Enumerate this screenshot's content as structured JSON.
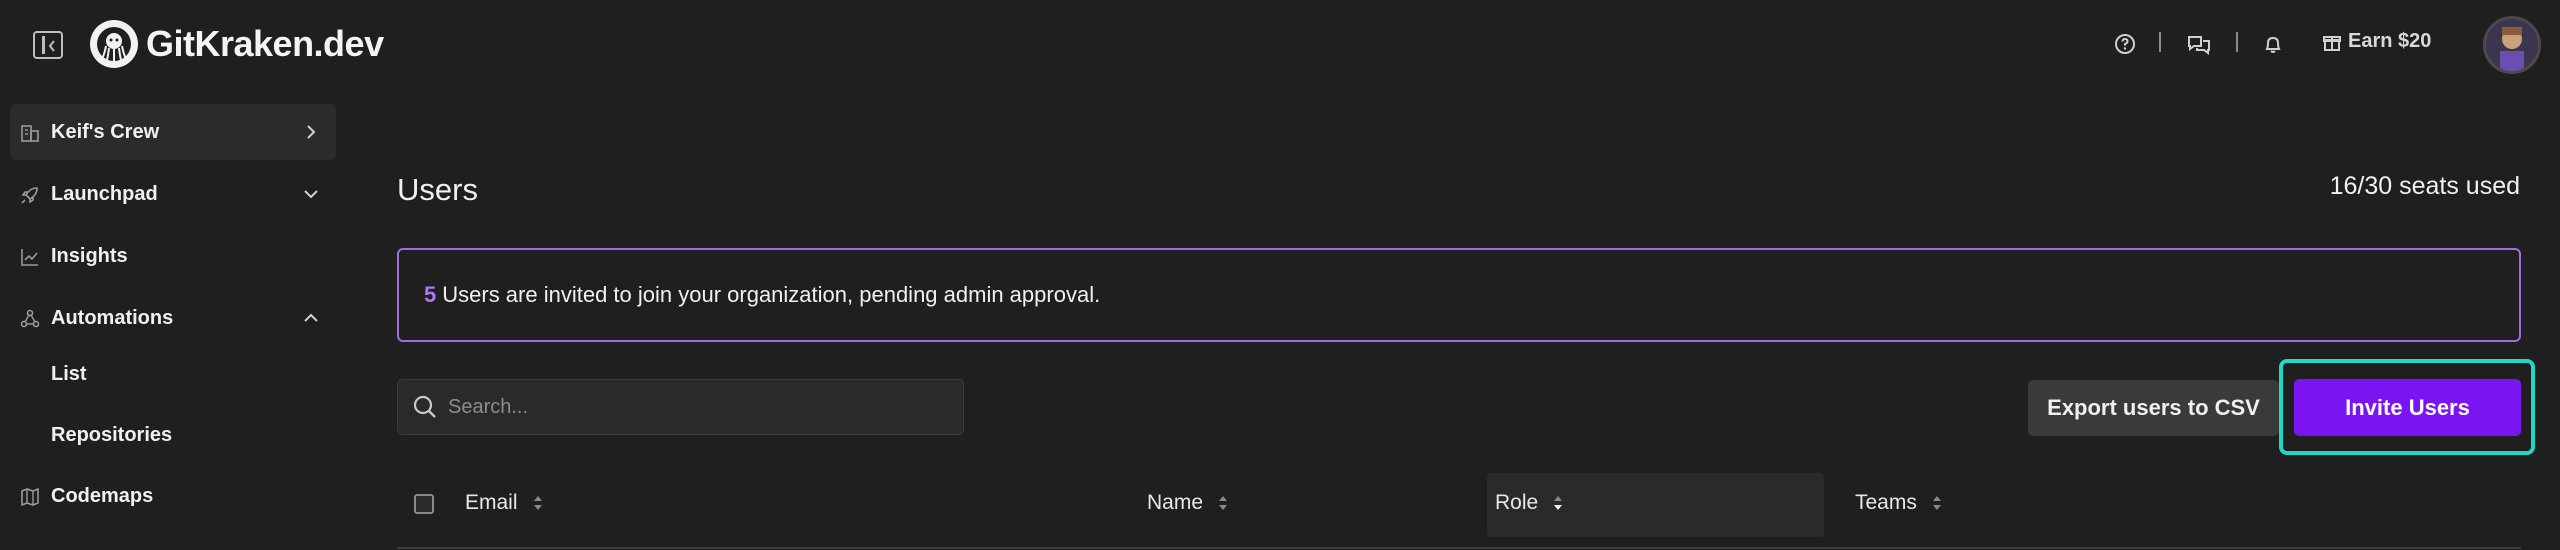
{
  "app": {
    "name": "GitKraken.dev"
  },
  "header": {
    "earn_label": "Earn $20",
    "icons": [
      "help-icon",
      "chat-icon",
      "bell-icon",
      "gift-icon"
    ]
  },
  "sidebar": {
    "items": [
      {
        "label": "Keif's Crew",
        "icon": "building-icon",
        "chevron": "right"
      },
      {
        "label": "Launchpad",
        "icon": "rocket-icon",
        "chevron": "down"
      },
      {
        "label": "Insights",
        "icon": "chart-icon"
      },
      {
        "label": "Automations",
        "icon": "automation-icon",
        "chevron": "up"
      },
      {
        "label": "List"
      },
      {
        "label": "Repositories"
      },
      {
        "label": "Codemaps",
        "icon": "map-icon"
      }
    ]
  },
  "main": {
    "title": "Users",
    "seats": "16/30 seats used",
    "banner": {
      "count": "5",
      "text": "Users are invited to join your organization, pending admin approval."
    },
    "search": {
      "placeholder": "Search...",
      "value": ""
    },
    "export_label": "Export users to CSV",
    "invite_label": "Invite Users",
    "table": {
      "columns": [
        "Email",
        "Name",
        "Role",
        "Teams"
      ]
    }
  },
  "colors": {
    "accent": "#7a15f2",
    "banner_border": "#a46be0",
    "focus_ring": "#22d7c9",
    "background": "#1f1f1f"
  }
}
